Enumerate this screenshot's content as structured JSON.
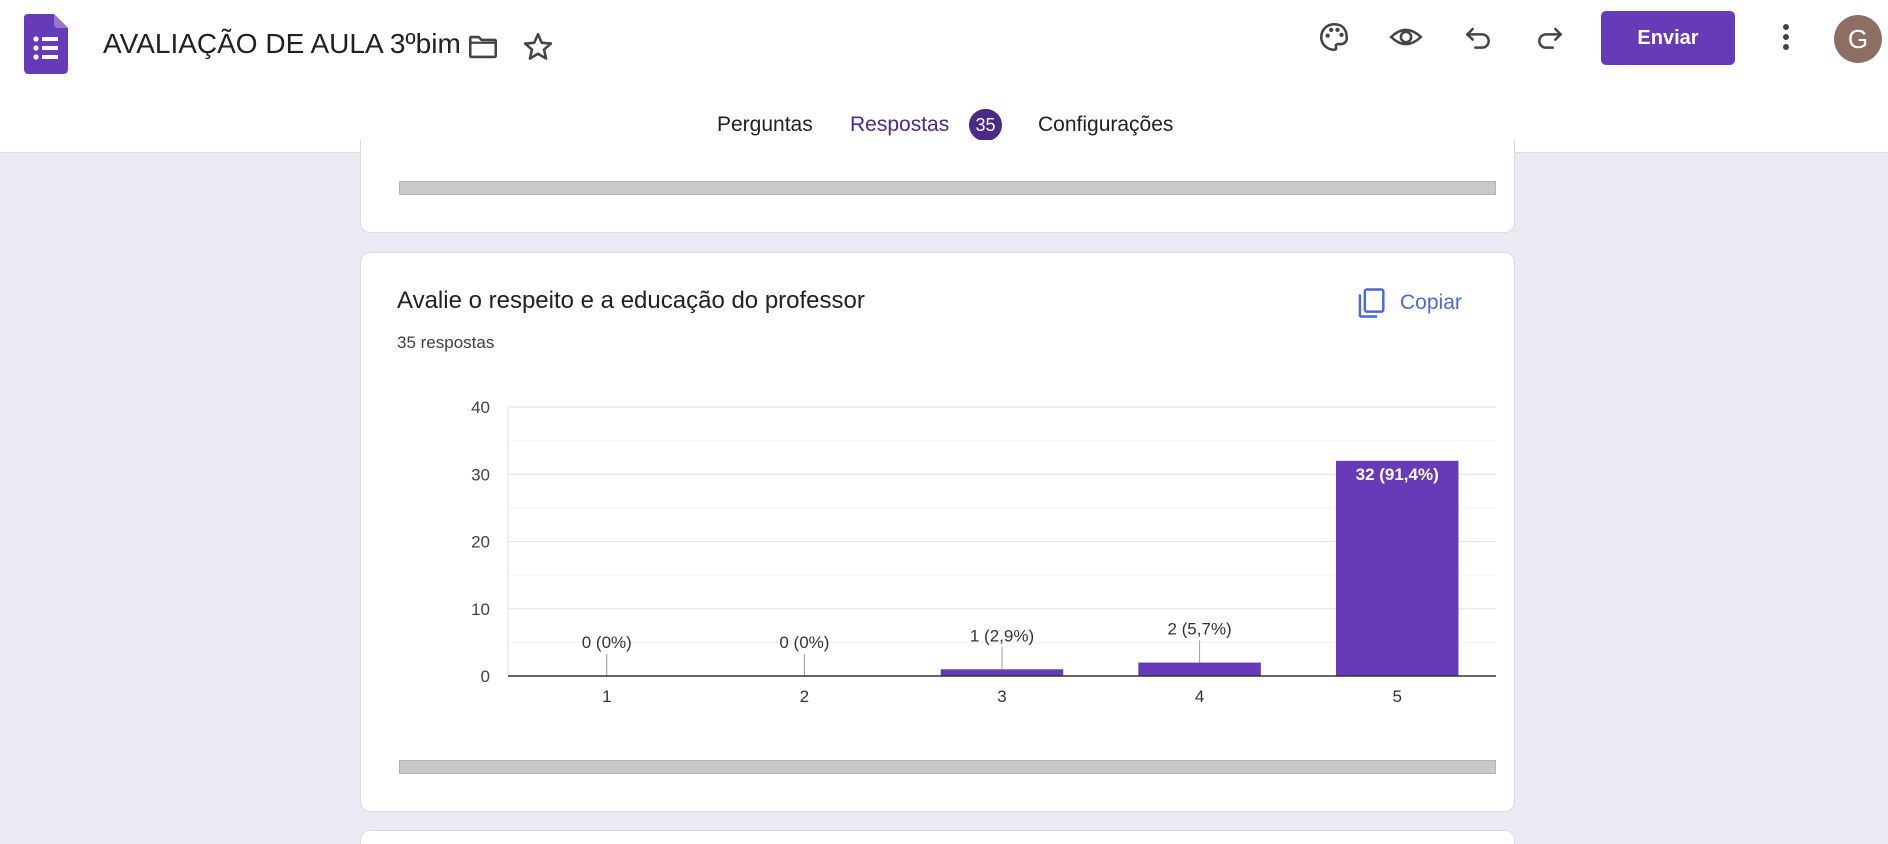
{
  "header": {
    "title": "AVALIAÇÃO DE AULA 3ºbim",
    "send_label": "Enviar",
    "avatar_initial": "G",
    "accent_color": "#673ab7"
  },
  "tabs": [
    {
      "label": "Perguntas"
    },
    {
      "label": "Respostas",
      "badge": "35",
      "active": true
    },
    {
      "label": "Configurações"
    }
  ],
  "question": {
    "title": "Avalie o respeito e a educação do professor",
    "response_count": "35 respostas",
    "copy_label": "Copiar"
  },
  "chart_data": {
    "type": "bar",
    "categories": [
      "1",
      "2",
      "3",
      "4",
      "5"
    ],
    "values": [
      0,
      0,
      1,
      2,
      32
    ],
    "data_labels": [
      "0 (0%)",
      "0 (0%)",
      "1 (2,9%)",
      "2 (5,7%)",
      "32 (91,4%)"
    ],
    "yticks": [
      0,
      10,
      20,
      30,
      40
    ],
    "ylim": [
      0,
      40
    ],
    "grid": true,
    "bar_color": "#673ab7"
  }
}
